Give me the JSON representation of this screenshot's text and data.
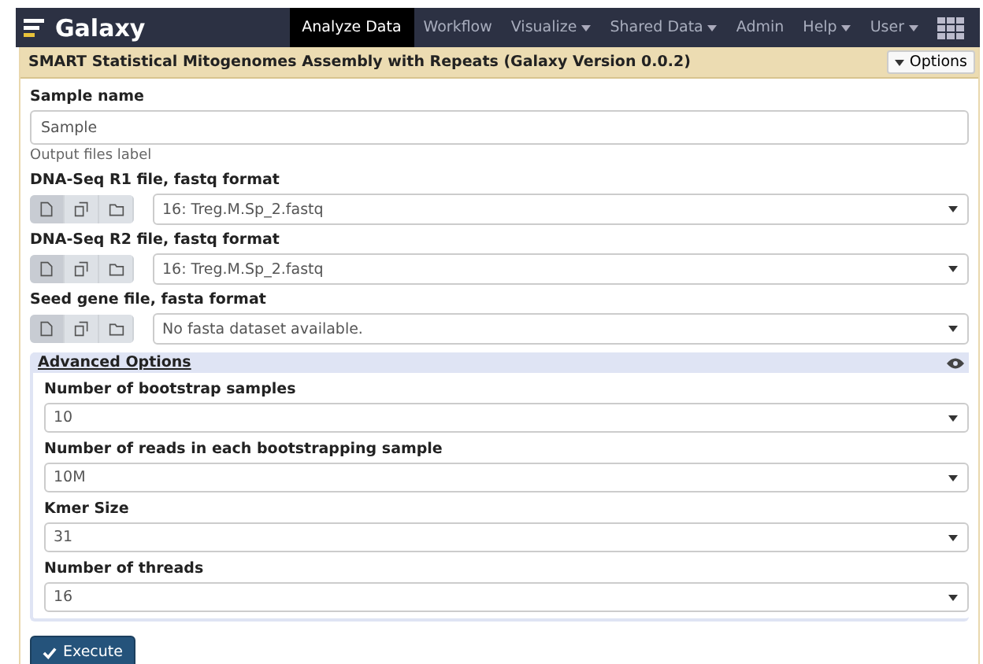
{
  "navbar": {
    "brand": "Galaxy",
    "items": [
      {
        "label": "Analyze Data",
        "selected": true,
        "dropdown": false
      },
      {
        "label": "Workflow",
        "selected": false,
        "dropdown": false
      },
      {
        "label": "Visualize",
        "selected": false,
        "dropdown": true
      },
      {
        "label": "Shared Data",
        "selected": false,
        "dropdown": true
      },
      {
        "label": "Admin",
        "selected": false,
        "dropdown": false
      },
      {
        "label": "Help",
        "selected": false,
        "dropdown": true
      },
      {
        "label": "User",
        "selected": false,
        "dropdown": true
      }
    ]
  },
  "tool": {
    "title": "SMART Statistical Mitogenomes Assembly with Repeats (Galaxy Version 0.0.2)",
    "options_button": "Options"
  },
  "params": [
    {
      "kind": "text",
      "label": "Sample name",
      "value": "Sample",
      "help": "Output files label"
    },
    {
      "kind": "dataset",
      "label": "DNA-Seq R1 file, fastq format",
      "value": "16: Treg.M.Sp_2.fastq",
      "sources": [
        {
          "selected": true
        },
        {
          "selected": false
        },
        {
          "selected": false
        }
      ]
    },
    {
      "kind": "dataset",
      "label": "DNA-Seq R2 file, fastq format",
      "value": "16: Treg.M.Sp_2.fastq",
      "sources": [
        {
          "selected": true
        },
        {
          "selected": false
        },
        {
          "selected": false
        }
      ]
    },
    {
      "kind": "dataset",
      "label": "Seed gene file, fasta format",
      "value": "No fasta dataset available.",
      "sources": [
        {
          "selected": true
        },
        {
          "selected": false
        },
        {
          "selected": false
        }
      ]
    }
  ],
  "advanced": {
    "title": "Advanced Options",
    "expanded": true,
    "params": [
      {
        "label": "Number of bootstrap samples",
        "value": "10"
      },
      {
        "label": "Number of reads in each bootstrapping sample",
        "value": "10M"
      },
      {
        "label": "Kmer Size",
        "value": "31"
      },
      {
        "label": "Number of threads",
        "value": "16"
      }
    ]
  },
  "execute_button": "Execute"
}
